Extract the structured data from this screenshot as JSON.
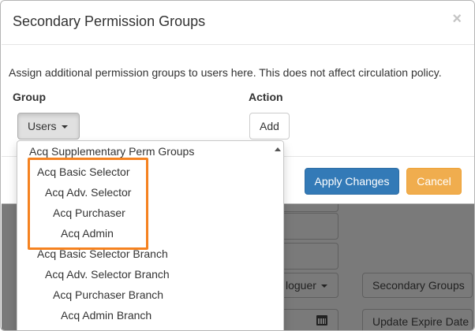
{
  "modal": {
    "title": "Secondary Permission Groups",
    "close_icon": "×",
    "description": "Assign additional permission groups to users here. This does not affect circulation policy.",
    "group_label": "Group",
    "action_label": "Action",
    "group_select": {
      "selected": "Users"
    },
    "add_label": "Add",
    "apply_label": "Apply Changes",
    "cancel_label": "Cancel"
  },
  "dropdown": {
    "items": [
      {
        "label": "Acq Supplementary Perm Groups",
        "level": 0
      },
      {
        "label": "Acq Basic Selector",
        "level": 1
      },
      {
        "label": "Acq Adv. Selector",
        "level": 2
      },
      {
        "label": "Acq Purchaser",
        "level": 3
      },
      {
        "label": "Acq Admin",
        "level": 4
      },
      {
        "label": "Acq Basic Selector Branch",
        "level": 1
      },
      {
        "label": "Acq Adv. Selector Branch",
        "level": 2
      },
      {
        "label": "Acq Purchaser Branch",
        "level": 3
      },
      {
        "label": "Acq Admin Branch",
        "level": 4
      }
    ]
  },
  "background": {
    "cataloguer_label": "loguer",
    "secondary_groups_label": "Secondary Groups",
    "update_expire_label": "Update Expire Date"
  },
  "colors": {
    "primary": "#337ab7",
    "warning": "#f0ad4e",
    "highlight": "#f58220"
  }
}
